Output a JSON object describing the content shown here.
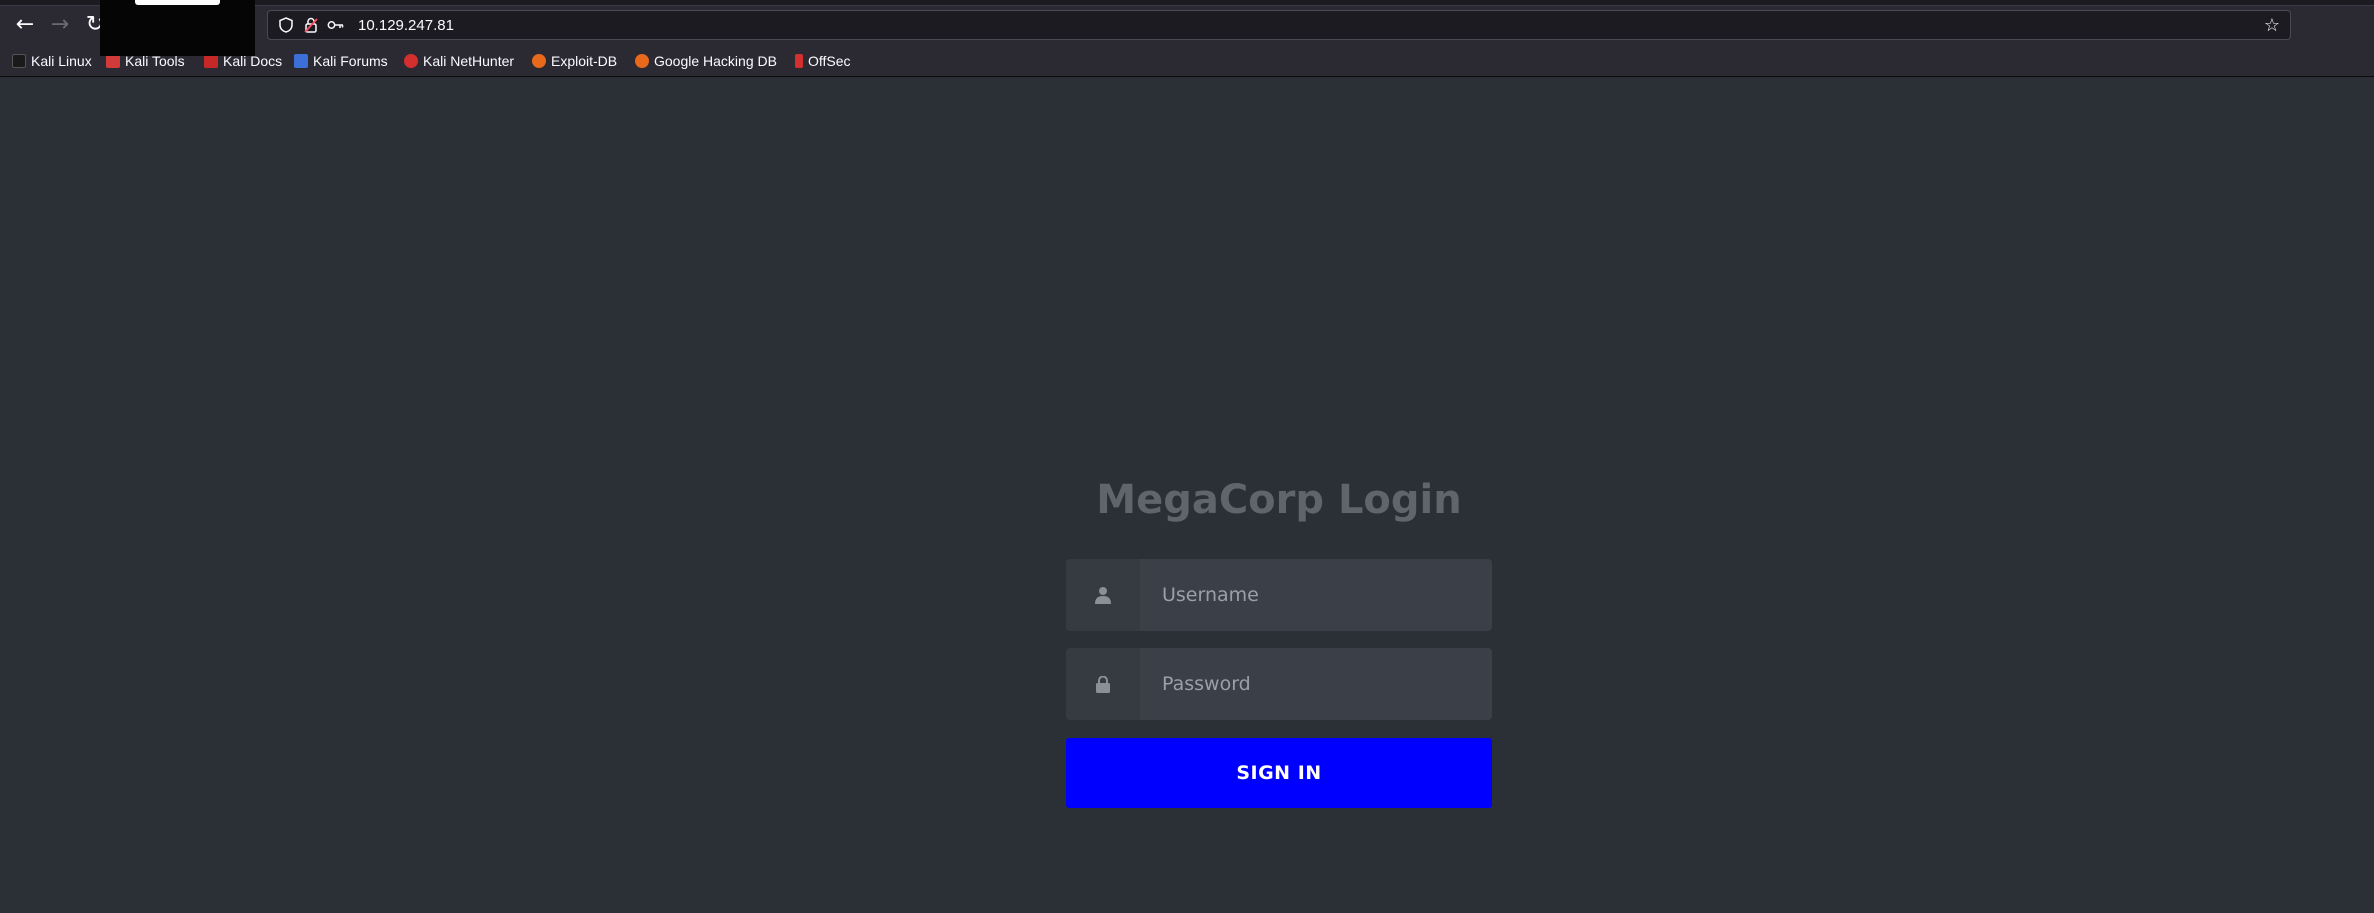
{
  "browser": {
    "url": "10.129.247.81",
    "bookmarks": [
      {
        "label": "Kali Linux",
        "color": "#1a1a1a"
      },
      {
        "label": "Kali Tools",
        "color": "#d33a3a"
      },
      {
        "label": "Kali Docs",
        "color": "#c62828"
      },
      {
        "label": "Kali Forums",
        "color": "#3c6fd8"
      },
      {
        "label": "Kali NetHunter",
        "color": "#d32f2f"
      },
      {
        "label": "Exploit-DB",
        "color": "#e8691c"
      },
      {
        "label": "Google Hacking DB",
        "color": "#e8691c"
      },
      {
        "label": "OffSec",
        "color": "#d32f2f"
      }
    ],
    "icons": [
      "back-arrow-icon",
      "forward-arrow-icon",
      "reload-icon",
      "home-icon",
      "shield-icon",
      "lock-icon",
      "key-icon",
      "star-icon"
    ]
  },
  "login": {
    "title": "MegaCorp Login",
    "username_placeholder": "Username",
    "password_placeholder": "Password",
    "signin_label": "SIGN IN",
    "button_color": "#0000ff"
  }
}
